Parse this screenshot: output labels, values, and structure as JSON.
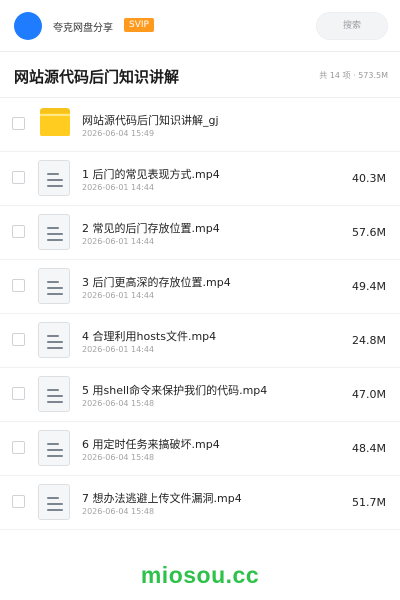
{
  "header": {
    "share_name": "夸克网盘分享",
    "badge": "SVIP",
    "search_placeholder": "搜索",
    "accent": "#1f7cff",
    "badge_color": "#ff9a1f"
  },
  "title_bar": {
    "title": "网站源代码后门知识讲解",
    "meta": "共 14 项 · 573.5M"
  },
  "files": [
    {
      "type": "folder",
      "icon": "folder-icon",
      "name": "网站源代码后门知识讲解_gj",
      "date": "2026-06-04 15:49",
      "size": ""
    },
    {
      "type": "file",
      "icon": "video-file-icon",
      "name": "1 后门的常见表现方式.mp4",
      "date": "2026-06-01 14:44",
      "size": "40.3M"
    },
    {
      "type": "file",
      "icon": "video-file-icon",
      "name": "2 常见的后门存放位置.mp4",
      "date": "2026-06-01 14:44",
      "size": "57.6M"
    },
    {
      "type": "file",
      "icon": "video-file-icon",
      "name": "3 后门更高深的存放位置.mp4",
      "date": "2026-06-01 14:44",
      "size": "49.4M"
    },
    {
      "type": "file",
      "icon": "video-file-icon",
      "name": "4 合理利用hosts文件.mp4",
      "date": "2026-06-01 14:44",
      "size": "24.8M"
    },
    {
      "type": "file",
      "icon": "video-file-icon",
      "name": "5 用shell命令来保护我们的代码.mp4",
      "date": "2026-06-04 15:48",
      "size": "47.0M"
    },
    {
      "type": "file",
      "icon": "video-file-icon",
      "name": "6 用定时任务来搞破坏.mp4",
      "date": "2026-06-04 15:48",
      "size": "48.4M"
    },
    {
      "type": "file",
      "icon": "video-file-icon",
      "name": "7 想办法逃避上传文件漏洞.mp4",
      "date": "2026-06-04 15:48",
      "size": "51.7M"
    }
  ],
  "footer": {
    "watermark": "miosou.cc",
    "watermark_color": "#2ec24a"
  }
}
